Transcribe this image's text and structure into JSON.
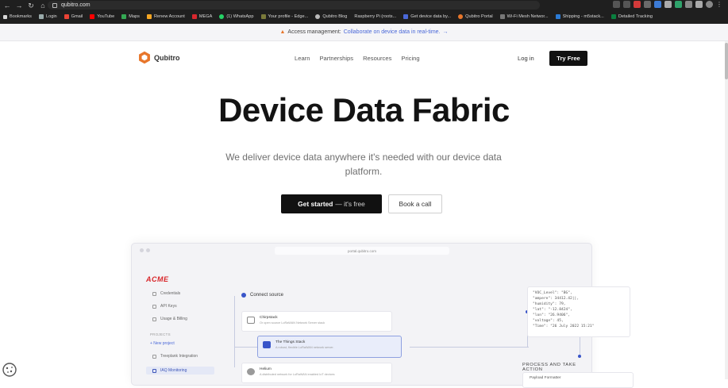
{
  "browser": {
    "url": "qubitro.com",
    "bookmarks": [
      "Bookmarks",
      "Login",
      "Gmail",
      "YouTube",
      "Maps",
      "Renew Account",
      "MEGA",
      "(1) WhatsApp",
      "Your profile - Edge...",
      "Qubitro Blog",
      "Raspberry Pi (roots...",
      "Get device data by...",
      "Qubitro Portal",
      "Wi-Fi Mesh Networ...",
      "Shipping - m5stack...",
      "Detailed Tracking"
    ]
  },
  "announcement": {
    "label": "Access management:",
    "link": "Collaborate on device data in real-time.",
    "arrow": "→"
  },
  "nav": {
    "logo": "Qubitro",
    "menu": [
      "Learn",
      "Partnerships",
      "Resources",
      "Pricing"
    ],
    "login": "Log in",
    "try_free": "Try Free"
  },
  "hero": {
    "title": "Device Data Fabric",
    "subtitle": "We deliver device data anywhere it's needed with our device data platform.",
    "cta_primary_bold": "Get started",
    "cta_primary_rest": "— it's free",
    "cta_secondary": "Book a call"
  },
  "preview": {
    "url": "portal.qubitro.com",
    "brand": "ACME",
    "side_items": [
      "Credentials",
      "API Keys",
      "Usage & Billing"
    ],
    "projects_heading": "PROJECTS",
    "new_project": "+ New project",
    "projects": [
      "Treeplank Integration",
      "IAQ Monitoring"
    ],
    "connect_label": "Connect source",
    "cards": [
      {
        "title": "Chirpstack",
        "sub": "Or open source LoRaWAN Network Server stack"
      },
      {
        "title": "The Things Stack",
        "sub": "A robust, flexible LoRaWAN network server."
      },
      {
        "title": "Helium",
        "sub": "A distributed network for LoRaWAN enabled IoT devices"
      }
    ],
    "json_lines": [
      "\"VOC_Level\": \"BG\",",
      "\"ampere\": 34412.42||,",
      "\"humidity\": 79,",
      "\"lat\": \"-12.8424\",",
      "\"lon\": \"26.9406\",",
      "\"voltage\": 45,",
      "\"Time\": \"26 July 2022 15:21\""
    ],
    "process_label": "PROCESS AND TAKE ACTION",
    "process_card": "Payload Formatter"
  },
  "colors": {
    "brand_orange": "#e8762b",
    "link_blue": "#4a68d8",
    "acme_red": "#d8262a"
  }
}
